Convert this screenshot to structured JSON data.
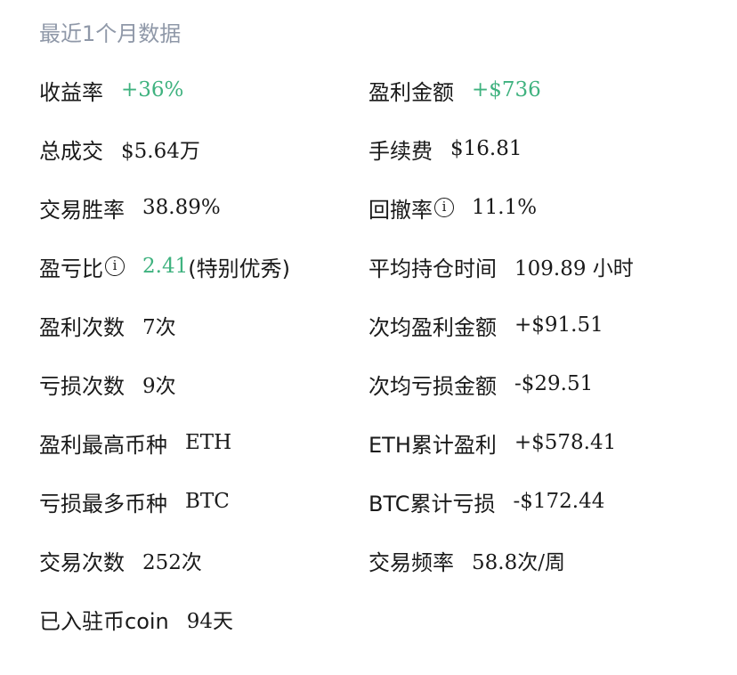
{
  "section": {
    "title": "最近1个月数据"
  },
  "colors": {
    "positive": "#3fb27f",
    "title_gray": "#8f98a8",
    "text": "#1a1a1a"
  },
  "stats": {
    "return_rate": {
      "label": "收益率",
      "value": "+36%"
    },
    "profit_amount": {
      "label": "盈利金额",
      "value": "+$736"
    },
    "total_volume": {
      "label": "总成交",
      "value": "$5.64万"
    },
    "fees": {
      "label": "手续费",
      "value": "$16.81"
    },
    "win_rate": {
      "label": "交易胜率",
      "value": "38.89%"
    },
    "drawdown": {
      "label": "回撤率",
      "value": "11.1%"
    },
    "pl_ratio": {
      "label": "盈亏比",
      "value": "2.41",
      "note": "(特别优秀)"
    },
    "avg_hold_time": {
      "label": "平均持仓时间",
      "value": "109.89 小时"
    },
    "win_count": {
      "label": "盈利次数",
      "value": "7次"
    },
    "avg_win": {
      "label": "次均盈利金额",
      "value": "+$91.51"
    },
    "loss_count": {
      "label": "亏损次数",
      "value": "9次"
    },
    "avg_loss": {
      "label": "次均亏损金额",
      "value": "-$29.51"
    },
    "top_profit_coin": {
      "label": "盈利最高币种",
      "value": "ETH"
    },
    "eth_cumulative": {
      "label": "ETH累计盈利",
      "value": "+$578.41"
    },
    "top_loss_coin": {
      "label": "亏损最多币种",
      "value": "BTC"
    },
    "btc_cumulative": {
      "label": "BTC累计亏损",
      "value": "-$172.44"
    },
    "trade_count": {
      "label": "交易次数",
      "value": "252次"
    },
    "trade_freq": {
      "label": "交易频率",
      "value": "58.8次/周"
    },
    "days_joined": {
      "label": "已入驻币coin",
      "value": "94天"
    }
  },
  "icons": {
    "info": "ⓘ-info-icon"
  }
}
